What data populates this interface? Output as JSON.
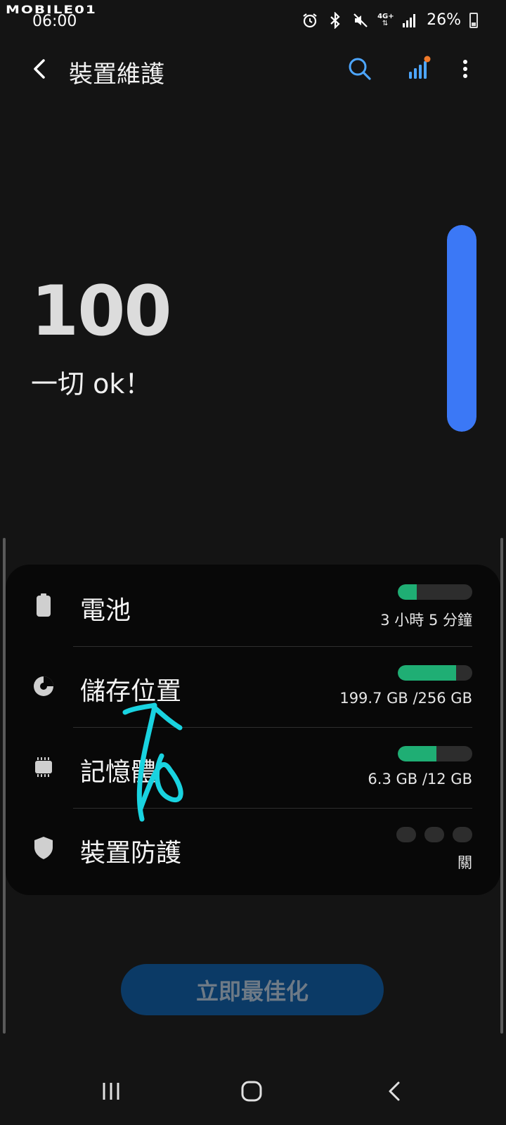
{
  "statusbar": {
    "watermark": "MOBILE01",
    "time": "06:00",
    "network": "4G+",
    "battery_percent": "26%"
  },
  "appbar": {
    "title": "裝置維護",
    "icons": [
      "back-arrow-icon",
      "search-icon",
      "stats-icon",
      "more-vert-icon"
    ],
    "accent_color": "#4da6ff",
    "notification_dot_color": "#f07a2a"
  },
  "score": {
    "value": "100",
    "status": "一切 ok！",
    "gauge_level": 1.0,
    "gauge_color": "#3b78f6"
  },
  "items": [
    {
      "label": "電池",
      "value": "3 小時 5 分鐘",
      "level": 0.25,
      "icon": "battery-icon"
    },
    {
      "label": "儲存位置",
      "value": "199.7 GB /256 GB",
      "level": 0.78,
      "icon": "storage-pie-icon"
    },
    {
      "label": "記憶體",
      "value": "6.3 GB /12 GB",
      "level": 0.52,
      "icon": "memory-chip-icon"
    },
    {
      "label": "裝置防護",
      "value": "關",
      "level": null,
      "icon": "shield-icon"
    }
  ],
  "bar_color": "#1fae74",
  "optimize_button": {
    "label": "立即最佳化"
  },
  "navbar": {
    "icons": [
      "recents-icon",
      "home-icon",
      "back-icon"
    ]
  }
}
